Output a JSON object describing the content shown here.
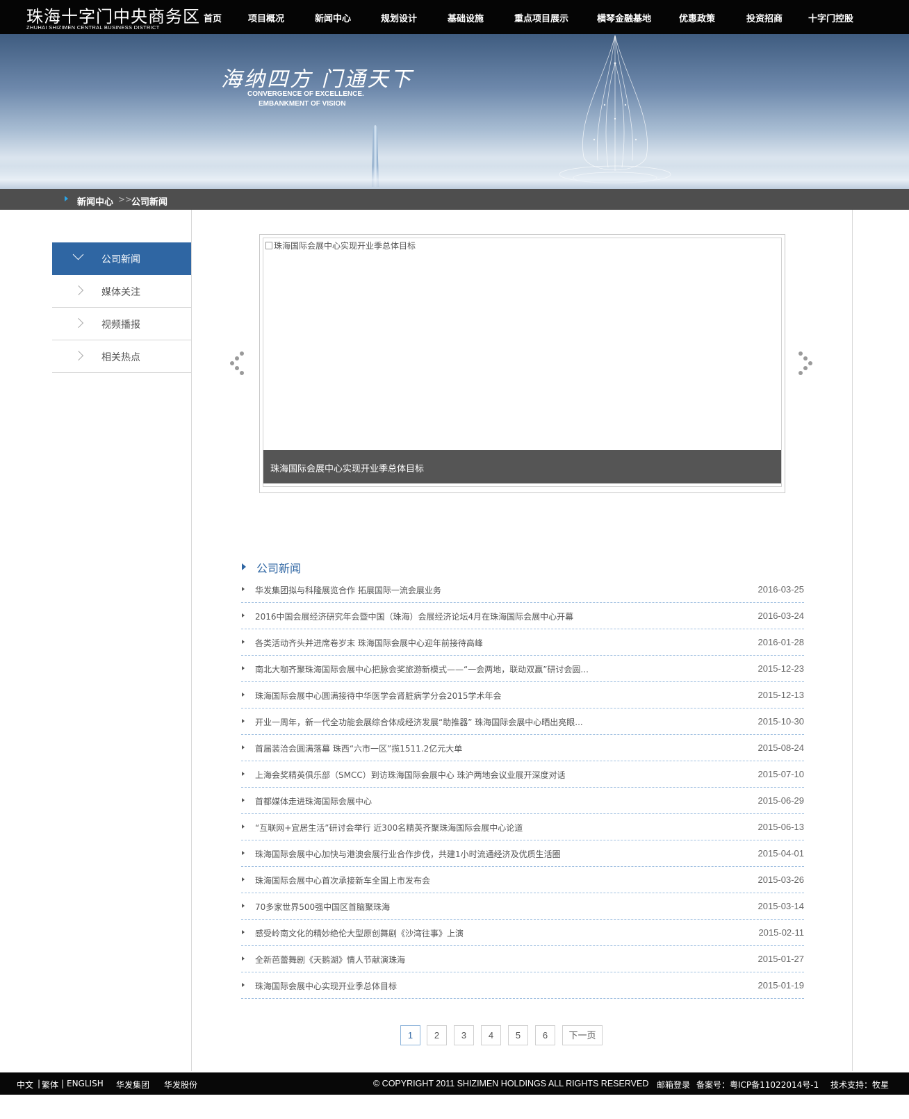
{
  "header": {
    "logo_cn": "珠海十字门中央商务区",
    "logo_en": "ZHUHAI SHIZIMEN CENTRAL BUSINESS DISTRICT",
    "nav": [
      "首页",
      "项目概况",
      "新闻中心",
      "规划设计",
      "基础设施",
      "重点项目展示",
      "横琴金融基地",
      "优惠政策",
      "投资招商",
      "十字门控股"
    ]
  },
  "banner": {
    "slogan": "海纳四方 门通天下",
    "en_line1": "CONVERGENCE OF EXCELLENCE.",
    "en_line2": "EMBANKMENT OF VISION"
  },
  "breadcrumb": {
    "parent": "新闻中心",
    "separator": ">>",
    "current": "公司新闻"
  },
  "sidebar": {
    "items": [
      {
        "label": "公司新闻",
        "active": true
      },
      {
        "label": "媒体关注",
        "active": false
      },
      {
        "label": "视频播报",
        "active": false
      },
      {
        "label": "相关热点",
        "active": false
      }
    ]
  },
  "slideshow": {
    "image_alt": "珠海国际会展中心实现开业季总体目标",
    "caption": "珠海国际会展中心实现开业季总体目标"
  },
  "news": {
    "heading": "公司新闻",
    "items": [
      {
        "title": "华发集团拟与科隆展览合作 拓展国际一流会展业务",
        "date": "2016-03-25"
      },
      {
        "title": "2016中国会展经济研究年会暨中国（珠海）会展经济论坛4月在珠海国际会展中心开幕",
        "date": "2016-03-24"
      },
      {
        "title": "各类活动齐头并进席卷岁末 珠海国际会展中心迎年前接待高峰",
        "date": "2016-01-28"
      },
      {
        "title": "南北大咖齐聚珠海国际会展中心把脉会奖旅游新模式——“一会两地，联动双赢”研讨会圆...",
        "date": "2015-12-23"
      },
      {
        "title": "珠海国际会展中心圆满接待中华医学会肾脏病学分会2015学术年会",
        "date": "2015-12-13"
      },
      {
        "title": "开业一周年，新一代全功能会展综合体成经济发展“助推器” 珠海国际会展中心晒出亮眼...",
        "date": "2015-10-30"
      },
      {
        "title": "首届装洽会圆满落幕 珠西“六市一区”揽1511.2亿元大单",
        "date": "2015-08-24"
      },
      {
        "title": "上海会奖精英俱乐部（SMCC）到访珠海国际会展中心 珠沪两地会议业展开深度对话",
        "date": "2015-07-10"
      },
      {
        "title": "首都媒体走进珠海国际会展中心",
        "date": "2015-06-29"
      },
      {
        "title": "“互联网+宜居生活”研讨会举行 近300名精英齐聚珠海国际会展中心论道",
        "date": "2015-06-13"
      },
      {
        "title": "珠海国际会展中心加快与港澳会展行业合作步伐，共建1小时流通经济及优质生活圈",
        "date": "2015-04-01"
      },
      {
        "title": "珠海国际会展中心首次承接新车全国上市发布会",
        "date": "2015-03-26"
      },
      {
        "title": "70多家世界500强中国区首脑聚珠海",
        "date": "2015-03-14"
      },
      {
        "title": "感受岭南文化的精妙绝伦大型原创舞剧《沙湾往事》上演",
        "date": "2015-02-11"
      },
      {
        "title": "全新芭蕾舞剧《天鹅湖》情人节献演珠海",
        "date": "2015-01-27"
      },
      {
        "title": "珠海国际会展中心实现开业季总体目标",
        "date": "2015-01-19"
      }
    ]
  },
  "pagination": {
    "pages": [
      "1",
      "2",
      "3",
      "4",
      "5",
      "6"
    ],
    "current": "1",
    "next_label": "下一页"
  },
  "footer": {
    "lang_cn": "中文",
    "lang_tw": "繁体",
    "lang_en": "ENGLISH",
    "divider": "|",
    "link1": "华发集团",
    "link2": "华发股份",
    "copyright": "© COPYRIGHT 2011 SHIZIMEN HOLDINGS ALL RIGHTS RESERVED",
    "mail_login": "邮箱登录",
    "icp": "备案号：粤ICP备11022014号-1",
    "support": "技术支持：牧星"
  },
  "colors": {
    "accent": "#2f66a3",
    "nav_bg": "#050505",
    "crumb_bg": "#4e4e4e",
    "caption_bg": "#555555"
  }
}
